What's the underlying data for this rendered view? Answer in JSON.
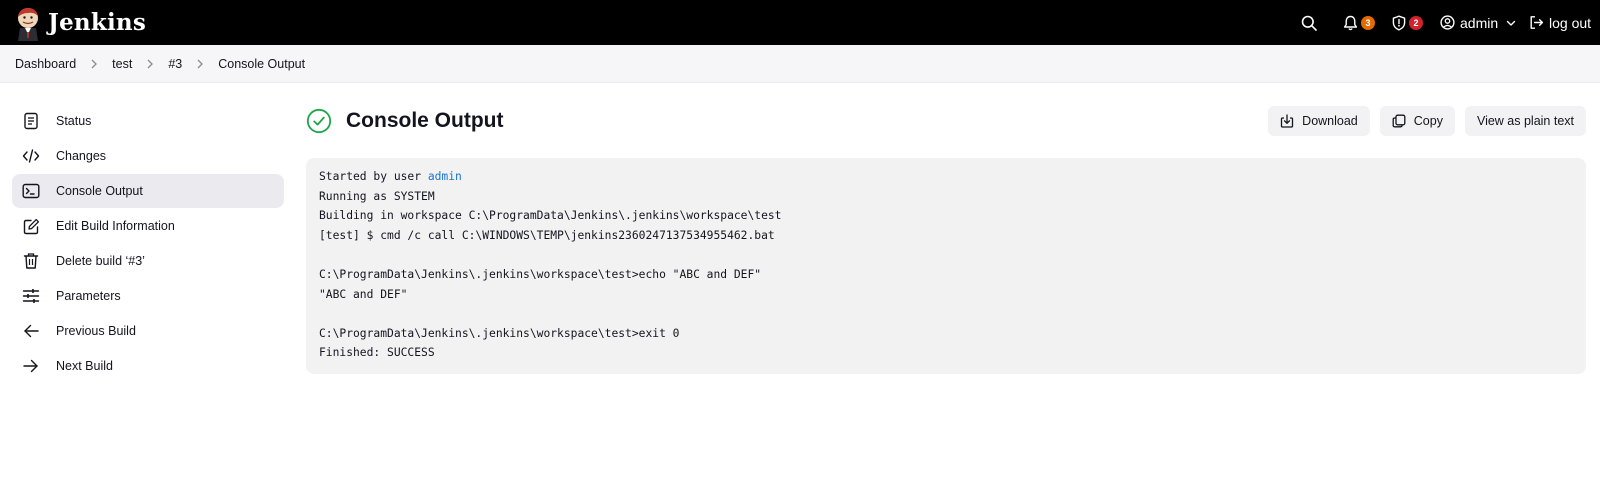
{
  "header": {
    "brand": "Jenkins",
    "search_icon": "search-icon",
    "notifications_count": "3",
    "security_count": "2",
    "user": "admin",
    "logout": "log out",
    "badge_colors": {
      "notifications": "#e56a00",
      "security": "#d2222d"
    }
  },
  "breadcrumb": [
    "Dashboard",
    "test",
    "#3",
    "Console Output"
  ],
  "sidebar": {
    "items": [
      {
        "label": "Status",
        "icon": "document-icon"
      },
      {
        "label": "Changes",
        "icon": "code-icon"
      },
      {
        "label": "Console Output",
        "icon": "terminal-icon",
        "active": true
      },
      {
        "label": "Edit Build Information",
        "icon": "edit-icon"
      },
      {
        "label": "Delete build ‘#3’",
        "icon": "trash-icon"
      },
      {
        "label": "Parameters",
        "icon": "sliders-icon"
      },
      {
        "label": "Previous Build",
        "icon": "arrow-left-icon"
      },
      {
        "label": "Next Build",
        "icon": "arrow-right-icon"
      }
    ]
  },
  "main": {
    "title": "Console Output",
    "status_icon": "success-check-icon",
    "status_color": "#1ea64b",
    "actions": {
      "download": "Download",
      "copy": "Copy",
      "plain_text": "View as plain text"
    },
    "console": {
      "started_prefix": "Started by user ",
      "started_user": "admin",
      "lines": [
        "Running as SYSTEM",
        "Building in workspace C:\\ProgramData\\Jenkins\\.jenkins\\workspace\\test",
        "[test] $ cmd /c call C:\\WINDOWS\\TEMP\\jenkins2360247137534955462.bat",
        "",
        "C:\\ProgramData\\Jenkins\\.jenkins\\workspace\\test>echo \"ABC and DEF\"",
        "\"ABC and DEF\"",
        "",
        "C:\\ProgramData\\Jenkins\\.jenkins\\workspace\\test>exit 0",
        "Finished: SUCCESS"
      ],
      "link_color": "#1c73d4"
    }
  }
}
